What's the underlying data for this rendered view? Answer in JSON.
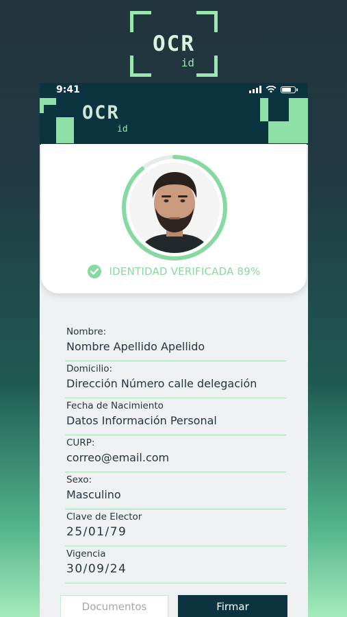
{
  "app": {
    "logo_text": "OCR",
    "logo_sub": "id"
  },
  "status_bar": {
    "time": "9:41"
  },
  "header": {
    "logo_text": "OCR",
    "logo_sub": "id"
  },
  "profile": {
    "verified_text": "IDENTIDAD VERIFICADA 89%",
    "verification_percent": 89,
    "accent_color": "#86d9a0"
  },
  "fields": [
    {
      "label": "Nombre:",
      "value": "Nombre Apellido Apellido"
    },
    {
      "label": "Domicilio:",
      "value": "Dirección Número calle delegación"
    },
    {
      "label": "Fecha de Nacimiento",
      "value": "Datos Información Personal"
    },
    {
      "label": "CURP:",
      "value": "correo@email.com"
    },
    {
      "label": "Sexo:",
      "value": "Masculino"
    },
    {
      "label": "Clave de Elector",
      "value": "25/01/79"
    },
    {
      "label": "Vigencia",
      "value": "30/09/24"
    }
  ],
  "buttons": {
    "documents": "Documentos",
    "sign": "Firmar"
  },
  "colors": {
    "brand_dark": "#0b3340",
    "brand_green": "#9be8ae"
  }
}
